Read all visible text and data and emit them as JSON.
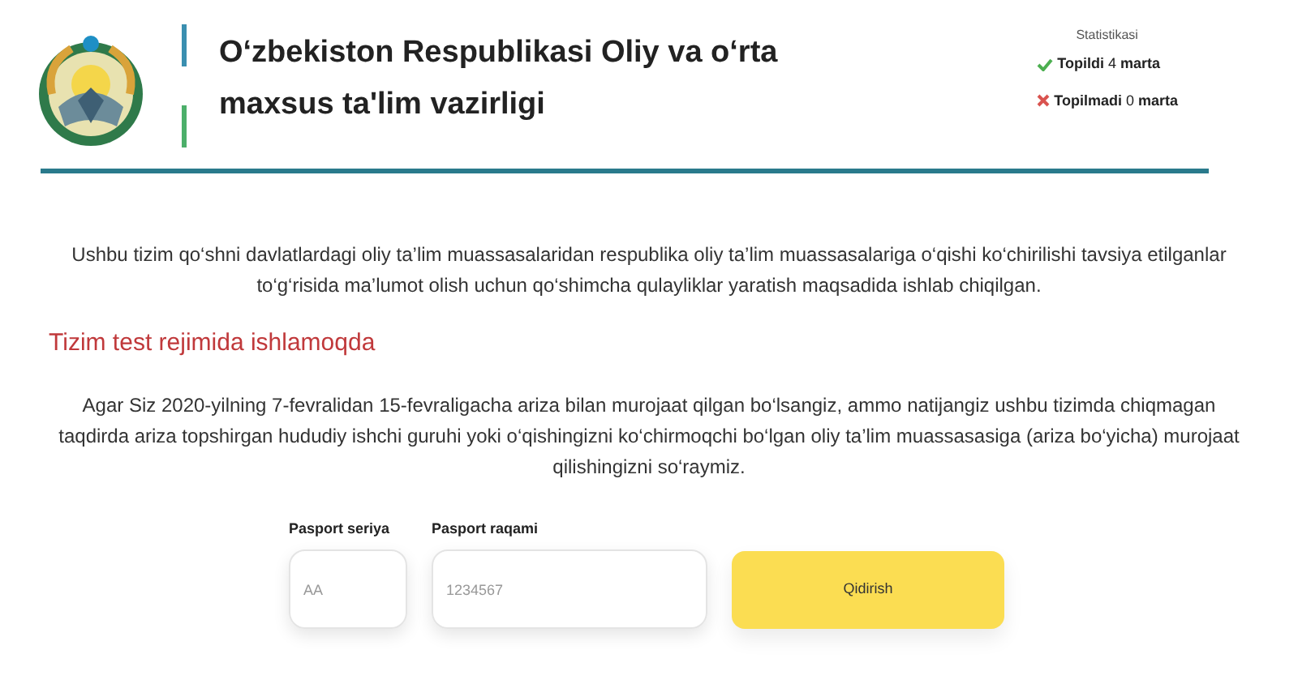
{
  "header": {
    "title": "O‘zbekiston Respublikasi Oliy va o‘rta maxsus ta'lim vazirligi"
  },
  "stats": {
    "title": "Statistikasi",
    "items": [
      {
        "kind": "found",
        "text": "**Topildi** 4 **marta**"
      },
      {
        "kind": "not_found",
        "text": "**Topilmadi** 0 **marta**"
      }
    ]
  },
  "intro": "Ushbu tizim qo‘shni davlatlardagi oliy ta’lim muassasalaridan respublika oliy ta’lim muassasalariga o‘qishi ko‘chirilishi tavsiya etilganlar to‘g‘risida ma’lumot olish uchun qo‘shimcha qulayliklar yaratish maqsadida ishlab chiqilgan.",
  "notice": "Tizim test rejimida ishlamoqda",
  "instructions": "Agar Siz 2020-yilning 7-fevralidan 15-fevraligacha ariza bilan murojaat qilgan bo‘lsangiz, ammo natijangiz ushbu tizimda chiqmagan taqdirda ariza topshirgan hududiy ishchi guruhi yoki o‘qishingizni ko‘chirmoqchi bo‘lgan oliy ta’lim muassasasiga (ariza bo‘yicha) murojaat qilishingizni so‘raymiz.",
  "form": {
    "fields": [
      {
        "label": "Pasport seriya",
        "placeholder": "AA"
      },
      {
        "label": "Pasport raqami",
        "placeholder": "1234567"
      }
    ],
    "button": "Qidirish"
  }
}
